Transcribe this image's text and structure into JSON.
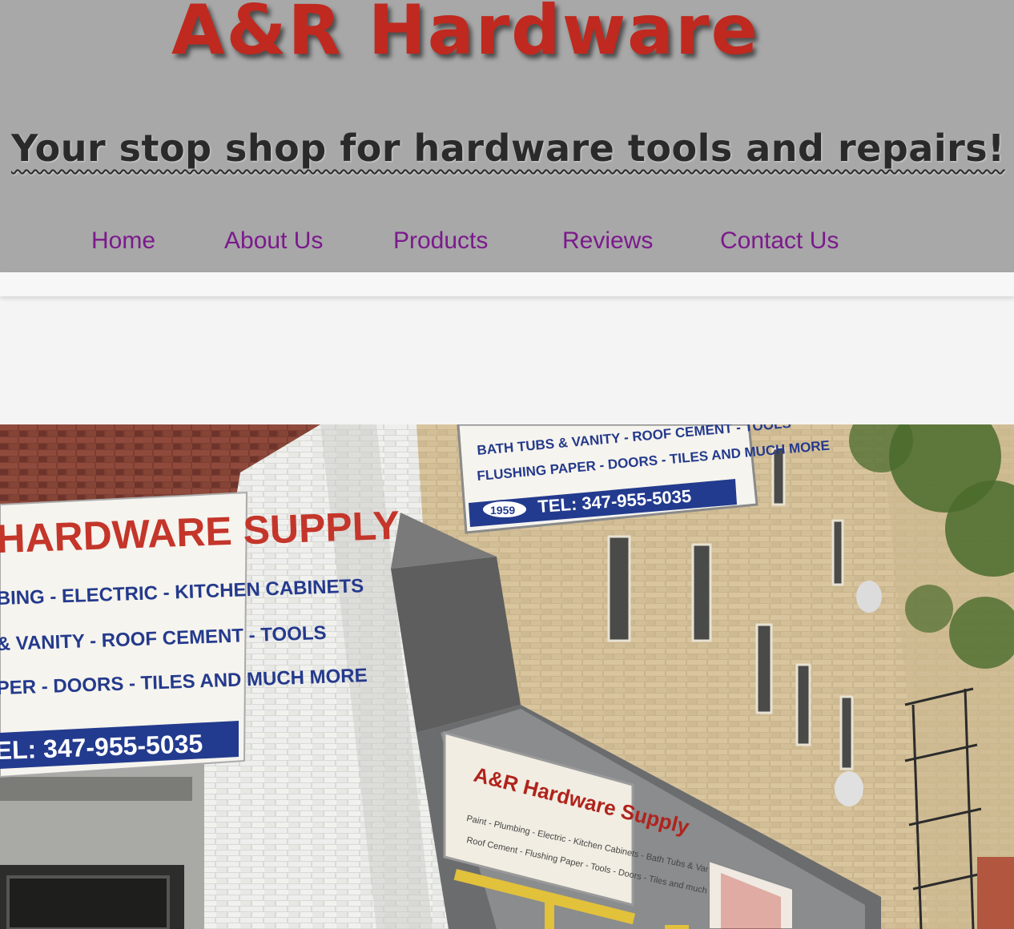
{
  "header": {
    "title": "A&R Hardware",
    "tagline": "Your stop shop for hardware tools and repairs!"
  },
  "nav": {
    "items": [
      {
        "label": "Home"
      },
      {
        "label": "About Us"
      },
      {
        "label": "Products"
      },
      {
        "label": "Reviews"
      },
      {
        "label": "Contact Us"
      }
    ]
  },
  "colors": {
    "header_bg": "#a8a8a8",
    "title": "#c0291f",
    "nav_link": "#7b1a8c",
    "body_bg": "#f4f4f4"
  },
  "hero_photo": {
    "left_sign": {
      "line1": "HARDWARE  SUPPLY",
      "line2": "BING - ELECTRIC - KITCHEN CABINETS",
      "line3": "& VANITY - ROOF CEMENT - TOOLS",
      "line4": "PER - DOORS - TILES AND MUCH MORE",
      "phone": "EL: 347-955-5035"
    },
    "top_sign": {
      "line1": "BATH TUBS & VANITY - ROOF CEMENT - TOOLS",
      "line2": "FLUSHING PAPER - DOORS - TILES AND MUCH MORE",
      "year": "1959",
      "phone": "TEL: 347-955-5035"
    },
    "storefront_sign": {
      "title": "A&R Hardware Supply",
      "line1": "Paint - Plumbing - Electric - Kitchen Cabinets - Bath Tubs & Vanity",
      "line2": "Roof Cement - Flushing Paper - Tools - Doors - Tiles and much more"
    }
  }
}
